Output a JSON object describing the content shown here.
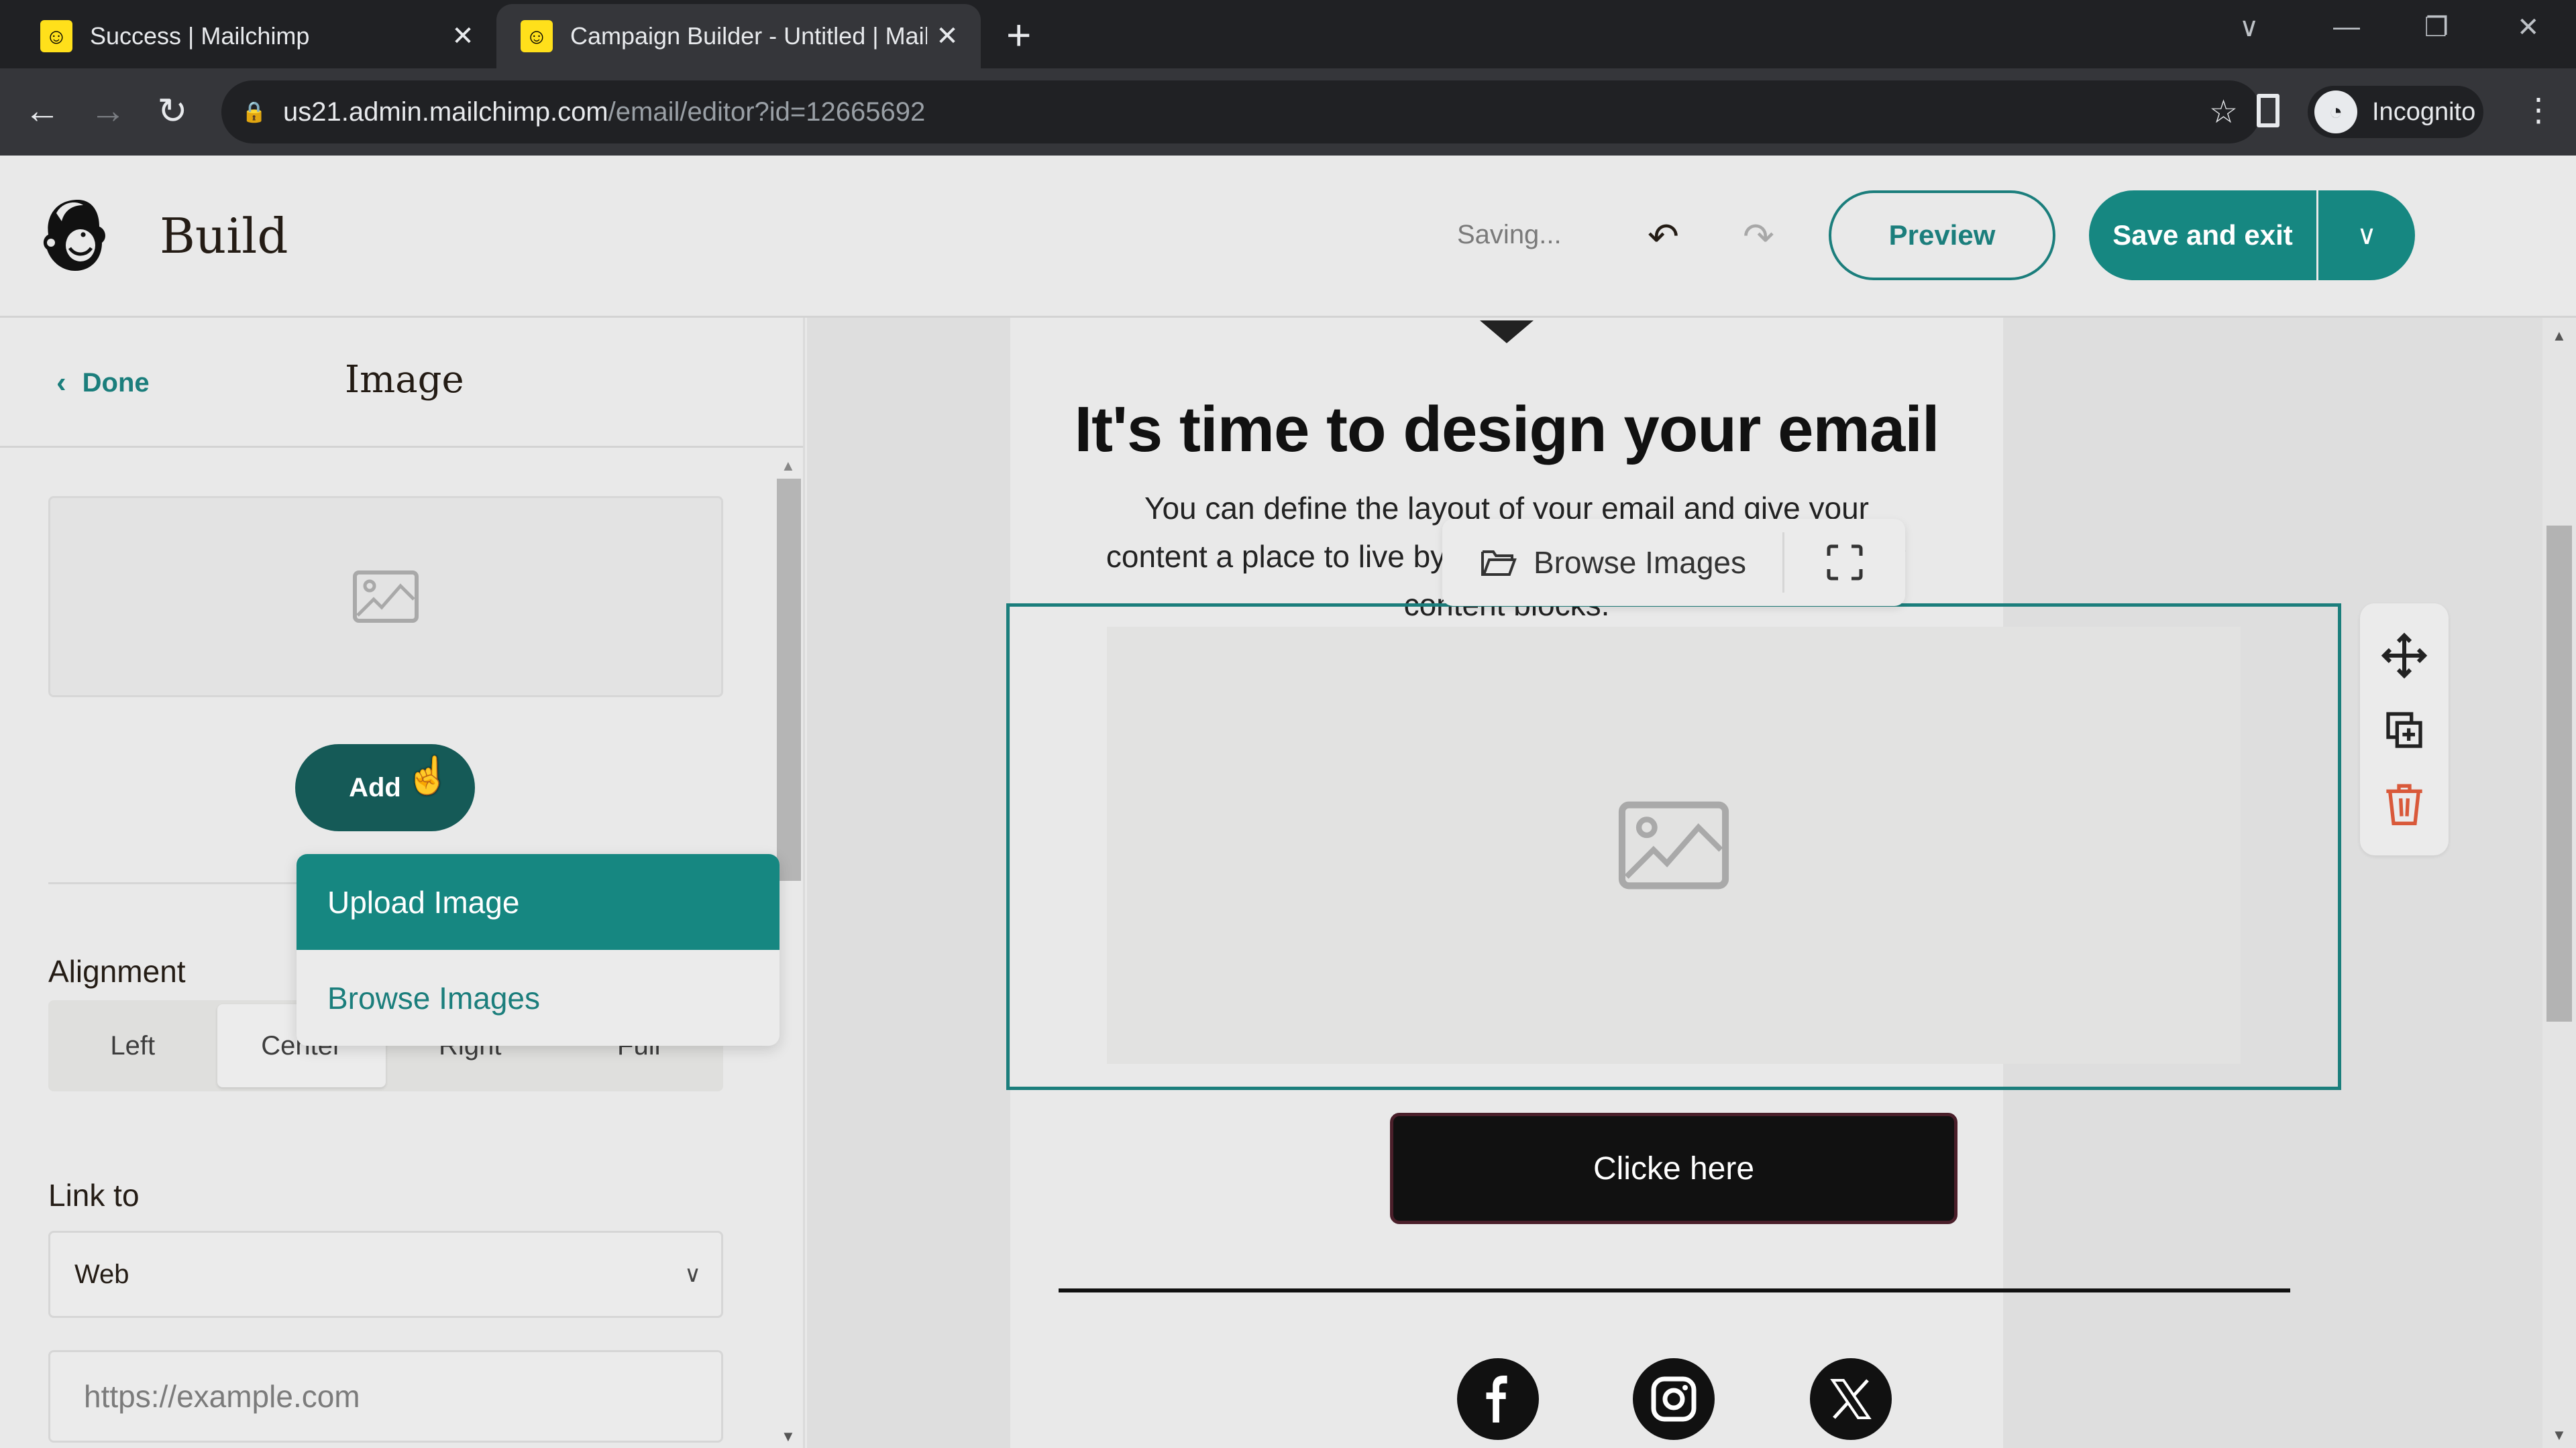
{
  "browser": {
    "tabs": [
      {
        "title": "Success | Mailchimp",
        "active": false
      },
      {
        "title": "Campaign Builder - Untitled | Mailchimp",
        "active": true
      }
    ],
    "new_tab_label": "+",
    "url_host": "us21.admin.mailchimp.com",
    "url_path": "/email/editor?id=12665692",
    "profile_label": "Incognito"
  },
  "header": {
    "title": "Build",
    "status": "Saving...",
    "preview_label": "Preview",
    "save_label": "Save and exit"
  },
  "panel": {
    "done_label": "Done",
    "title": "Image",
    "add_label": "Add",
    "add_menu": [
      {
        "label": "Upload Image",
        "highlighted": true
      },
      {
        "label": "Browse Images",
        "highlighted": false
      }
    ],
    "alignment_label": "Alignment",
    "alignment_options": [
      "Left",
      "Center",
      "Right",
      "Full"
    ],
    "alignment_selected": "Center",
    "link_label": "Link to",
    "link_type": "Web",
    "url_placeholder": "https://example.com"
  },
  "email": {
    "heading": "It's time to design your email",
    "body": "You can define the layout of your email and give your content a place to live by adding, rearranging, and deleting content blocks.",
    "image_toolbar_browse": "Browse Images",
    "cta_label": "Clicke here",
    "social": [
      "facebook",
      "instagram",
      "x"
    ]
  },
  "colors": {
    "brand_teal": "#168781",
    "dark_teal": "#155a57",
    "delete_red": "#d9593a",
    "mailchimp_yellow": "#ffe01b"
  }
}
